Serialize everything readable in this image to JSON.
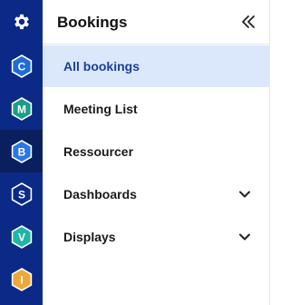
{
  "rail": {
    "settings_icon": "gear-icon",
    "items": [
      {
        "letter": "C",
        "color": "#1e6cd9",
        "active": false
      },
      {
        "letter": "M",
        "color": "#1a9c8c",
        "active": false
      },
      {
        "letter": "B",
        "color": "#2a76e6",
        "active": true
      },
      {
        "letter": "S",
        "color": "#0b2a87",
        "active": false
      },
      {
        "letter": "V",
        "color": "#1fb5a8",
        "active": false
      },
      {
        "letter": "I",
        "color": "#f0a73a",
        "active": false
      }
    ]
  },
  "panel": {
    "title": "Bookings",
    "collapse_icon": "double-chevron-left-icon"
  },
  "nav": {
    "items": [
      {
        "label": "All bookings",
        "active": true
      },
      {
        "label": "Meeting List"
      },
      {
        "label": "Ressourcer"
      },
      {
        "label": "Dashboards",
        "expandable": true
      },
      {
        "label": "Displays",
        "expandable": true
      }
    ]
  },
  "colors": {
    "rail_bg": "#0b2a87",
    "active_bg": "#dbe8fb",
    "active_text": "#1c3f9c"
  }
}
